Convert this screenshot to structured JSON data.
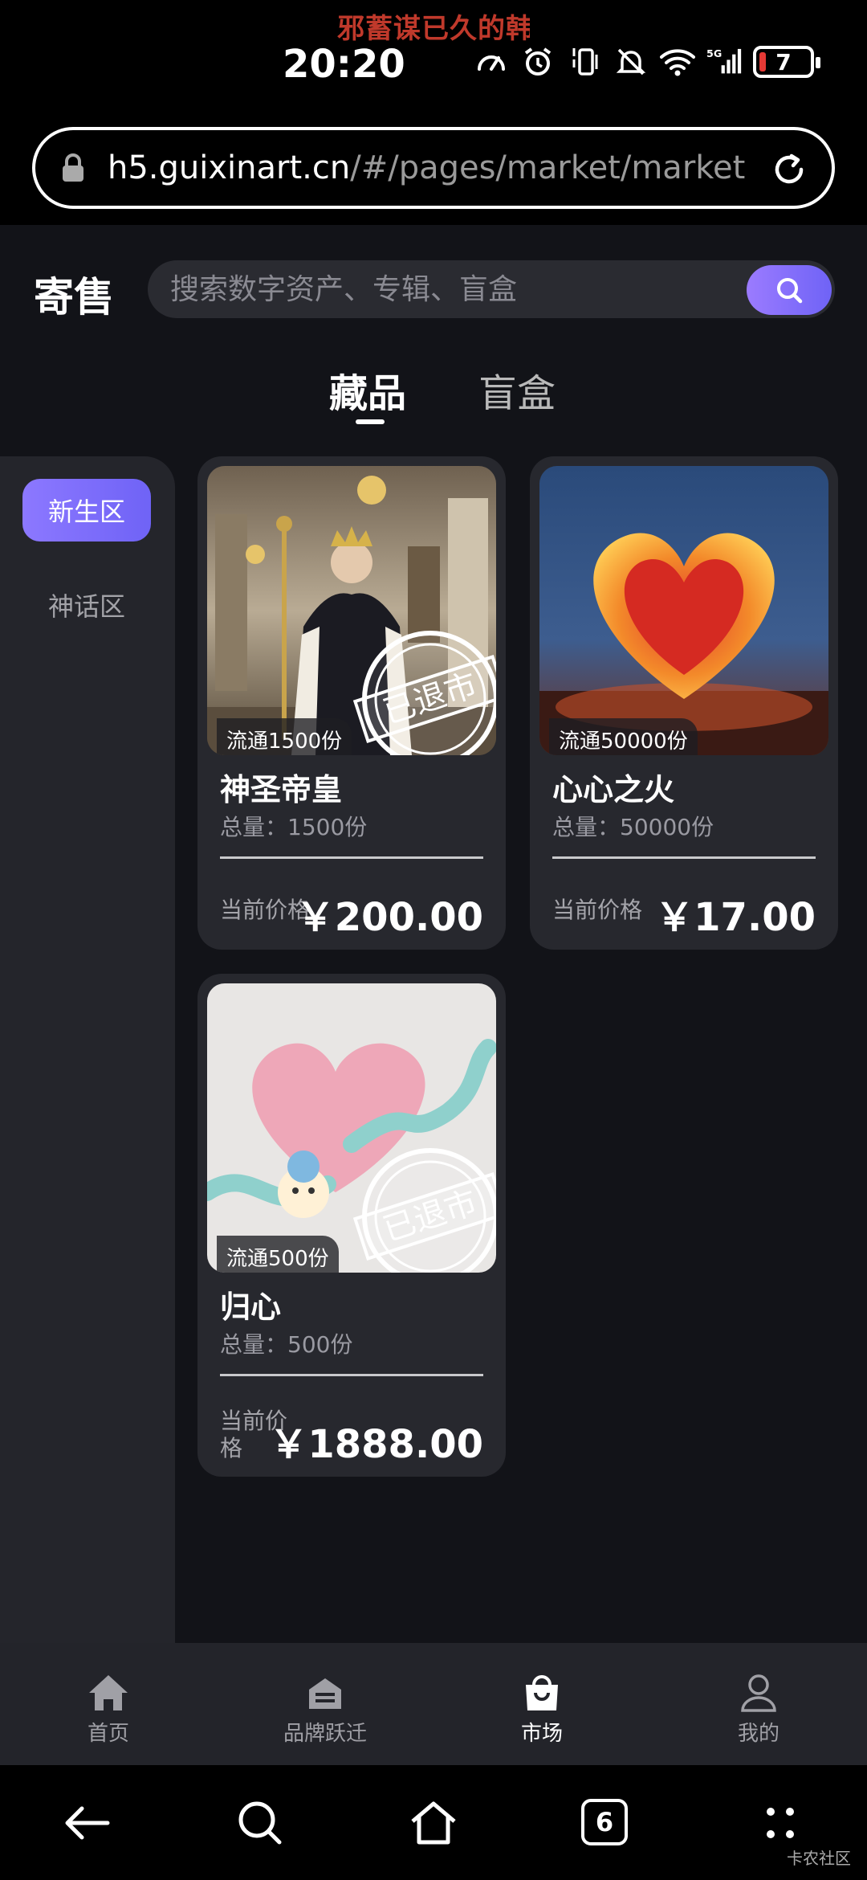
{
  "status_bar": {
    "ticker": "邪蓄谋已久的韩",
    "time": "20:20",
    "battery": "7",
    "network": "5G",
    "icons": [
      "speedometer-icon",
      "alarm-icon",
      "vibrate-icon",
      "mute-bell-icon",
      "wifi-icon",
      "signal-icon",
      "battery-icon"
    ]
  },
  "browser": {
    "url_host": "h5.guixinart.cn",
    "url_path": "/#/pages/market/market"
  },
  "header": {
    "title": "寄售",
    "search_placeholder": "搜索数字资产、专辑、盲盒"
  },
  "tabs": [
    {
      "label": "藏品",
      "active": true
    },
    {
      "label": "盲盒",
      "active": false
    }
  ],
  "sidebar": {
    "items": [
      {
        "label": "新生区",
        "active": true
      },
      {
        "label": "神话区",
        "active": false
      }
    ]
  },
  "cards": [
    {
      "circulation": "流通1500份",
      "title": "神圣帝皇",
      "total": "总量：1500份",
      "price_label": "当前价格",
      "price": "￥200.00",
      "stamp": "已退市"
    },
    {
      "circulation": "流通50000份",
      "title": "心心之火",
      "total": "总量：50000份",
      "price_label": "当前价格",
      "price": "￥17.00"
    },
    {
      "circulation": "流通500份",
      "title": "归心",
      "total": "总量：500份",
      "price_label": "当前价格",
      "price": "￥1888.00",
      "stamp": "已退市"
    }
  ],
  "bottom_nav": [
    {
      "label": "首页",
      "icon": "home-icon",
      "active": false
    },
    {
      "label": "品牌跃迁",
      "icon": "box-icon",
      "active": false
    },
    {
      "label": "市场",
      "icon": "shopping-bag-icon",
      "active": true
    },
    {
      "label": "我的",
      "icon": "user-icon",
      "active": false
    }
  ],
  "system_nav": {
    "tabs_count": "6",
    "watermark": "卡农社区"
  },
  "colors": {
    "accent": "#7b6cf8",
    "page_bg": "#121318",
    "card_bg": "#27282e"
  }
}
